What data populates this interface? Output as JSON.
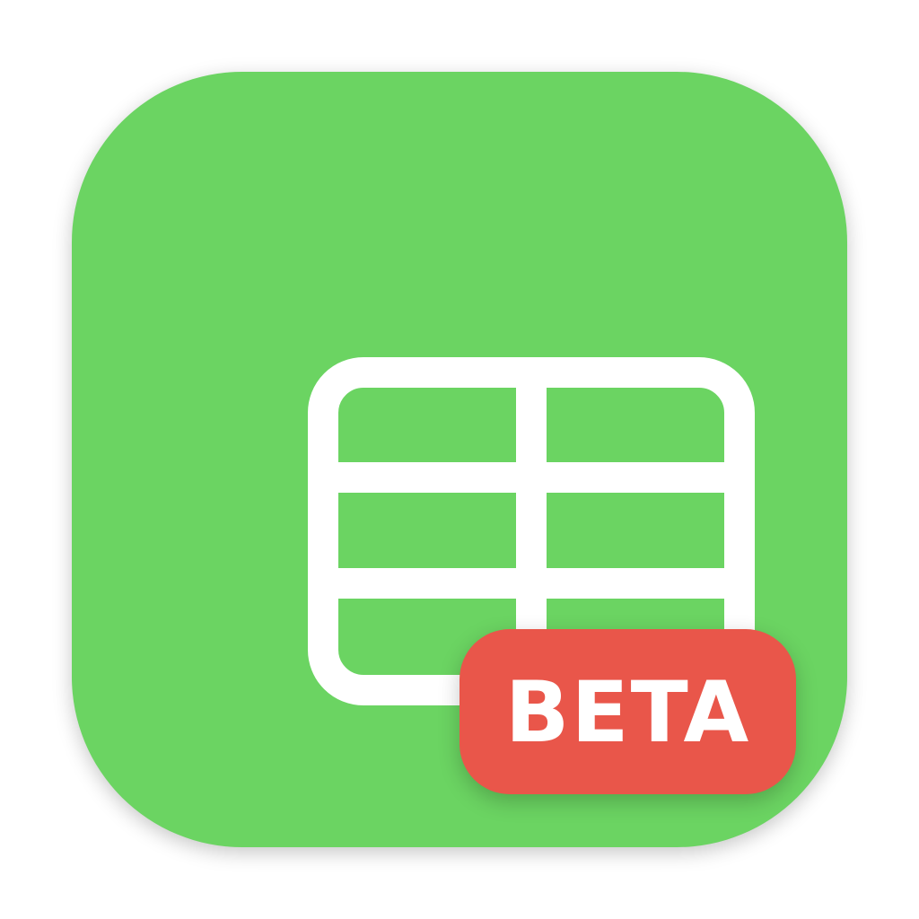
{
  "app_icon": {
    "glyph": "table-grid-icon",
    "background_color": "#6bd462",
    "glyph_color": "#ffffff"
  },
  "badge": {
    "label": "BETA",
    "color": "#e9564a",
    "text_color": "#ffffff"
  }
}
